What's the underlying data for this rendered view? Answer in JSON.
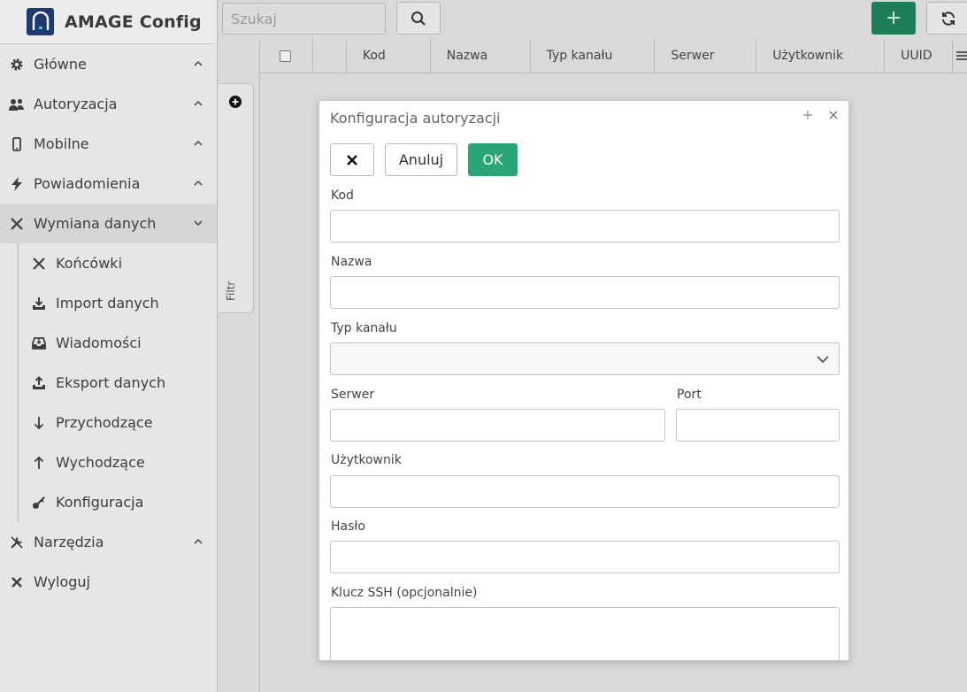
{
  "app": {
    "title": "AMAGE Config"
  },
  "sidebar": {
    "items": [
      {
        "label": "Główne",
        "icon": "gear-icon"
      },
      {
        "label": "Autoryzacja",
        "icon": "users-icon"
      },
      {
        "label": "Mobilne",
        "icon": "mobile-icon"
      },
      {
        "label": "Powiadomienia",
        "icon": "bolt-icon"
      },
      {
        "label": "Wymiana danych",
        "icon": "exchange-icon"
      }
    ],
    "subitems": [
      {
        "label": "Końcówki",
        "icon": "cross-icon"
      },
      {
        "label": "Import danych",
        "icon": "download-tray-icon"
      },
      {
        "label": "Wiadomości",
        "icon": "inbox-icon"
      },
      {
        "label": "Eksport danych",
        "icon": "upload-tray-icon"
      },
      {
        "label": "Przychodzące",
        "icon": "arrow-down-icon"
      },
      {
        "label": "Wychodzące",
        "icon": "arrow-up-icon"
      },
      {
        "label": "Konfiguracja",
        "icon": "key-icon"
      }
    ],
    "bottom": [
      {
        "label": "Narzędzia",
        "icon": "tools-icon"
      },
      {
        "label": "Wyloguj",
        "icon": "logout-icon"
      }
    ]
  },
  "toolbar": {
    "search_placeholder": "Szukaj",
    "add_label": "+"
  },
  "filter": {
    "label": "Filtr"
  },
  "table": {
    "columns": [
      "Kod",
      "Nazwa",
      "Typ kanału",
      "Serwer",
      "Użytkownik",
      "UUID"
    ]
  },
  "dialog": {
    "title": "Konfiguracja autoryzacji",
    "cancel_label": "Anuluj",
    "ok_label": "OK",
    "fields": {
      "kod": {
        "label": "Kod",
        "value": ""
      },
      "nazwa": {
        "label": "Nazwa",
        "value": ""
      },
      "typ": {
        "label": "Typ kanału",
        "value": ""
      },
      "serwer": {
        "label": "Serwer",
        "value": ""
      },
      "port": {
        "label": "Port",
        "value": ""
      },
      "uzytkownik": {
        "label": "Użytkownik",
        "value": ""
      },
      "haslo": {
        "label": "Hasło",
        "value": ""
      },
      "klucz": {
        "label": "Klucz SSH (opcjonalnie)",
        "value": ""
      }
    }
  },
  "colors": {
    "primary": "#2aa577",
    "add_button": "#1e7e58",
    "logo": "#1f3a6e"
  }
}
